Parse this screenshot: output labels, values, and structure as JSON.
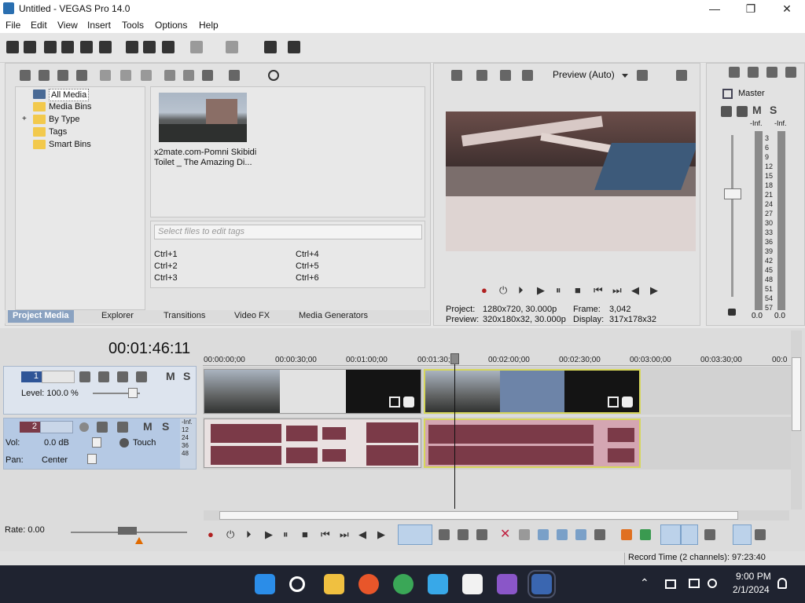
{
  "window": {
    "title": "Untitled - VEGAS Pro 14.0",
    "minimize": "—",
    "maximize": "❐",
    "close": "✕"
  },
  "menu": [
    "File",
    "Edit",
    "View",
    "Insert",
    "Tools",
    "Options",
    "Help"
  ],
  "project_media": {
    "tree": [
      "All Media",
      "Media Bins",
      "By Type",
      "Tags",
      "Smart Bins"
    ],
    "expander": "+",
    "media_item": {
      "name_line1": "x2mate.com-Pomni Skibidi",
      "name_line2": "Toilet _ The Amazing Di..."
    },
    "tags_placeholder": "Select files to edit tags",
    "shortcuts": [
      "Ctrl+1",
      "Ctrl+2",
      "Ctrl+3",
      "Ctrl+4",
      "Ctrl+5",
      "Ctrl+6"
    ]
  },
  "tabs": [
    "Project Media",
    "Explorer",
    "Transitions",
    "Video FX",
    "Media Generators"
  ],
  "preview": {
    "mode": "Preview (Auto)",
    "project_label": "Project:",
    "project_value": "1280x720, 30.000p",
    "preview_label": "Preview:",
    "preview_value": "320x180x32, 30.000p",
    "frame_label": "Frame:",
    "frame_value": "3,042",
    "display_label": "Display:",
    "display_value": "317x178x32"
  },
  "mixer": {
    "title": "Master",
    "m": "M",
    "s": "S",
    "peak_left": "-Inf.",
    "peak_right": "-Inf.",
    "scale": [
      "3",
      "6",
      "9",
      "12",
      "15",
      "18",
      "21",
      "24",
      "27",
      "30",
      "33",
      "36",
      "39",
      "42",
      "45",
      "48",
      "51",
      "54",
      "57"
    ],
    "gain_left": "0.0",
    "gain_right": "0.0"
  },
  "timeline": {
    "time": "00:01:46:11",
    "ruler": [
      "00:00:00;00",
      "00:00:30;00",
      "00:01:00;00",
      "00:01:30;00",
      "00:02:00;00",
      "00:02:30;00",
      "00:03:00;00",
      "00:03:30;00",
      "00:0"
    ],
    "track1": {
      "number": "1",
      "level_label": "Level: 100.0 %",
      "m": "M",
      "s": "S"
    },
    "track2": {
      "number": "2",
      "m": "M",
      "s": "S",
      "vol_label": "Vol:",
      "vol_value": "0.0 dB",
      "pan_label": "Pan:",
      "pan_value": "Center",
      "automation": "Touch",
      "meter_scale": [
        "-Inf.",
        "12",
        "24",
        "36",
        "48"
      ]
    },
    "rate": "Rate: 0.00"
  },
  "status": {
    "record_time": "Record Time (2 channels): 97:23:40"
  },
  "taskbar": {
    "time": "9:00 PM",
    "date": "2/1/2024"
  },
  "colors": {
    "accent": "#8aa2c1",
    "audio_clip": "#7b3a48",
    "clip_border": "#d6d65a",
    "taskbar": "#1f2330"
  }
}
